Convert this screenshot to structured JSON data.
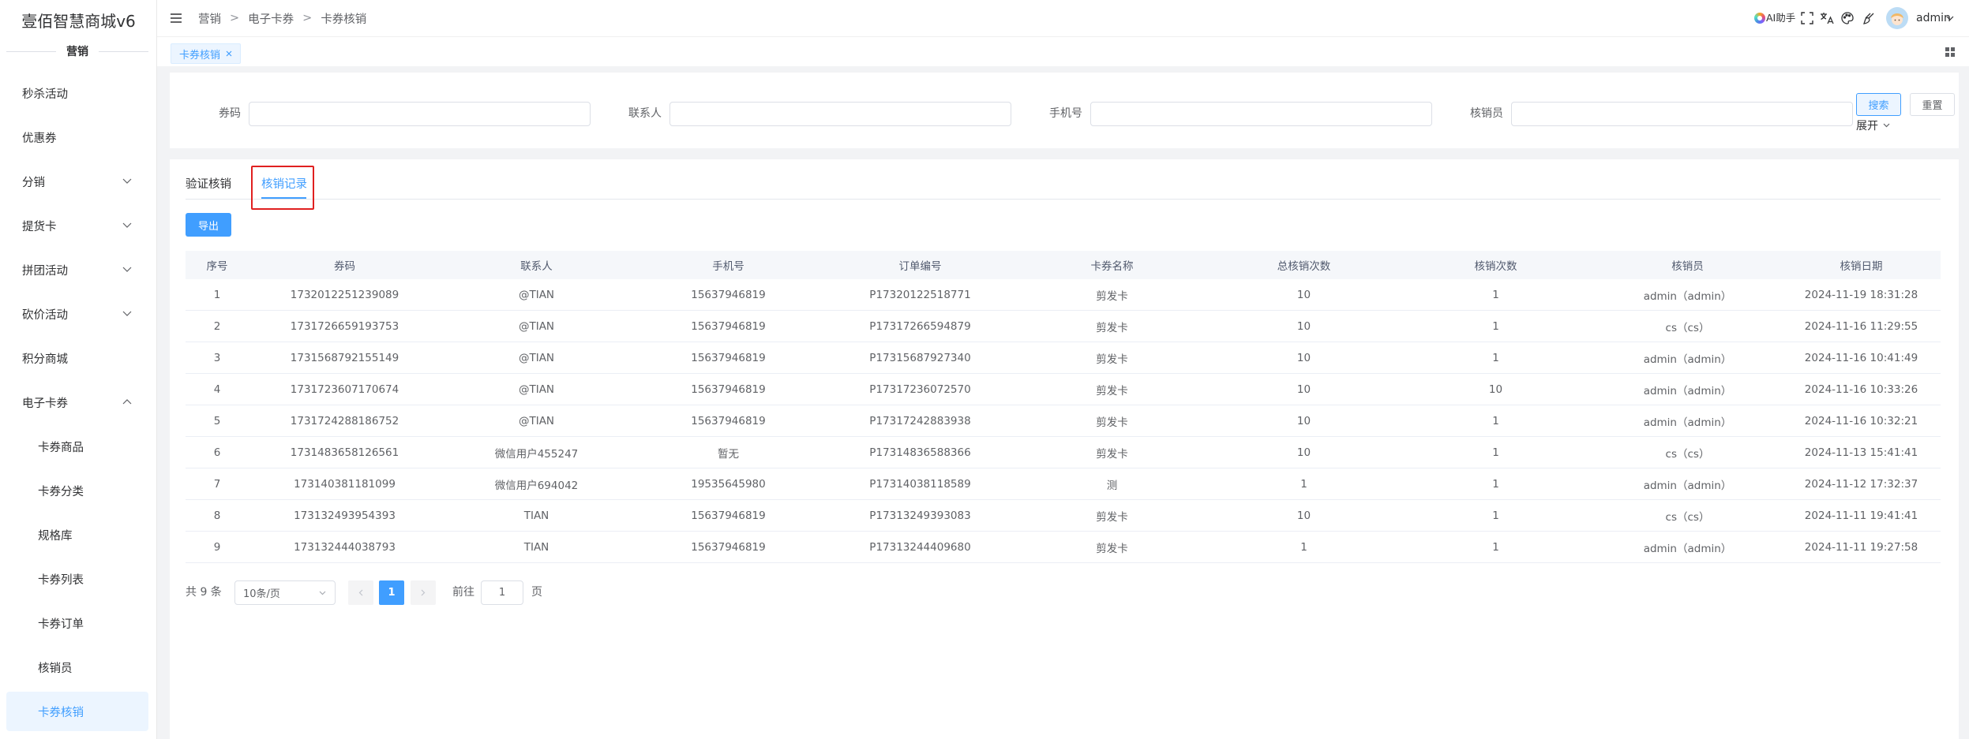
{
  "app": {
    "title": "壹佰智慧商城v6"
  },
  "sidebar": {
    "section_label": "营销",
    "items": [
      {
        "label": "秒杀活动"
      },
      {
        "label": "优惠券"
      },
      {
        "label": "分销",
        "icon": "chevron-down-icon"
      },
      {
        "label": "提货卡",
        "icon": "chevron-down-icon"
      },
      {
        "label": "拼团活动",
        "icon": "chevron-down-icon"
      },
      {
        "label": "砍价活动",
        "icon": "chevron-down-icon"
      },
      {
        "label": "积分商城"
      },
      {
        "label": "电子卡券",
        "icon": "chevron-up-icon",
        "expanded": true
      },
      {
        "label": "卡券商品",
        "sub": true
      },
      {
        "label": "卡券分类",
        "sub": true
      },
      {
        "label": "规格库",
        "sub": true
      },
      {
        "label": "卡券列表",
        "sub": true
      },
      {
        "label": "卡券订单",
        "sub": true
      },
      {
        "label": "核销员",
        "sub": true
      },
      {
        "label": "卡券核销",
        "sub": true,
        "active": true
      }
    ]
  },
  "header": {
    "breadcrumb": [
      "营销",
      "电子卡券",
      "卡券核销"
    ],
    "breadcrumb_separator": ">",
    "ai_assistant_label": "AI助手",
    "toolbar_icons": [
      "fullscreen-icon",
      "translate-icon",
      "palette-icon",
      "brush-icon"
    ],
    "user_name": "admin"
  },
  "tabs_bar": {
    "tabs": [
      {
        "label": "卡券核销",
        "active": true,
        "closable": true
      }
    ]
  },
  "search": {
    "fields": [
      {
        "label": "券码",
        "value": ""
      },
      {
        "label": "联系人",
        "value": ""
      },
      {
        "label": "手机号",
        "value": ""
      },
      {
        "label": "核销员",
        "value": ""
      }
    ],
    "search_button": "搜索",
    "reset_button": "重置",
    "expand_label": "展开"
  },
  "content": {
    "tabs": [
      {
        "label": "验证核销"
      },
      {
        "label": "核销记录",
        "active": true,
        "highlighted": true
      }
    ],
    "export_button": "导出"
  },
  "table": {
    "columns": [
      "序号",
      "券码",
      "联系人",
      "手机号",
      "订单编号",
      "卡券名称",
      "总核销次数",
      "核销次数",
      "核销员",
      "核销日期"
    ],
    "rows": [
      [
        1,
        "1732012251239089",
        "@TIAN",
        "15637946819",
        "P17320122518771",
        "剪发卡",
        10,
        1,
        "admin（admin）",
        "2024-11-19 18:31:28"
      ],
      [
        2,
        "1731726659193753",
        "@TIAN",
        "15637946819",
        "P17317266594879",
        "剪发卡",
        10,
        1,
        "cs（cs）",
        "2024-11-16 11:29:55"
      ],
      [
        3,
        "1731568792155149",
        "@TIAN",
        "15637946819",
        "P17315687927340",
        "剪发卡",
        10,
        1,
        "admin（admin）",
        "2024-11-16 10:41:49"
      ],
      [
        4,
        "1731723607170674",
        "@TIAN",
        "15637946819",
        "P17317236072570",
        "剪发卡",
        10,
        10,
        "admin（admin）",
        "2024-11-16 10:33:26"
      ],
      [
        5,
        "1731724288186752",
        "@TIAN",
        "15637946819",
        "P17317242883938",
        "剪发卡",
        10,
        1,
        "admin（admin）",
        "2024-11-16 10:32:21"
      ],
      [
        6,
        "1731483658126561",
        "微信用户455247",
        "暂无",
        "P17314836588366",
        "剪发卡",
        10,
        1,
        "cs（cs）",
        "2024-11-13 15:41:41"
      ],
      [
        7,
        "173140381181099",
        "微信用户694042",
        "19535645980",
        "P17314038118589",
        "测",
        1,
        1,
        "admin（admin）",
        "2024-11-12 17:32:37"
      ],
      [
        8,
        "173132493954393",
        "TIAN",
        "15637946819",
        "P17313249393083",
        "剪发卡",
        10,
        1,
        "cs（cs）",
        "2024-11-11 19:41:41"
      ],
      [
        9,
        "173132444038793",
        "TIAN",
        "15637946819",
        "P17313244409680",
        "剪发卡",
        1,
        1,
        "admin（admin）",
        "2024-11-11 19:27:58"
      ]
    ]
  },
  "pagination": {
    "total": "共 9 条",
    "page_size": "10条/页",
    "current_page": "1",
    "goto_label": "前往",
    "goto_value": "1",
    "goto_suffix": "页"
  },
  "colors": {
    "primary": "#409eff",
    "active_bg": "#ecf5ff",
    "annotation": "#e02020"
  }
}
